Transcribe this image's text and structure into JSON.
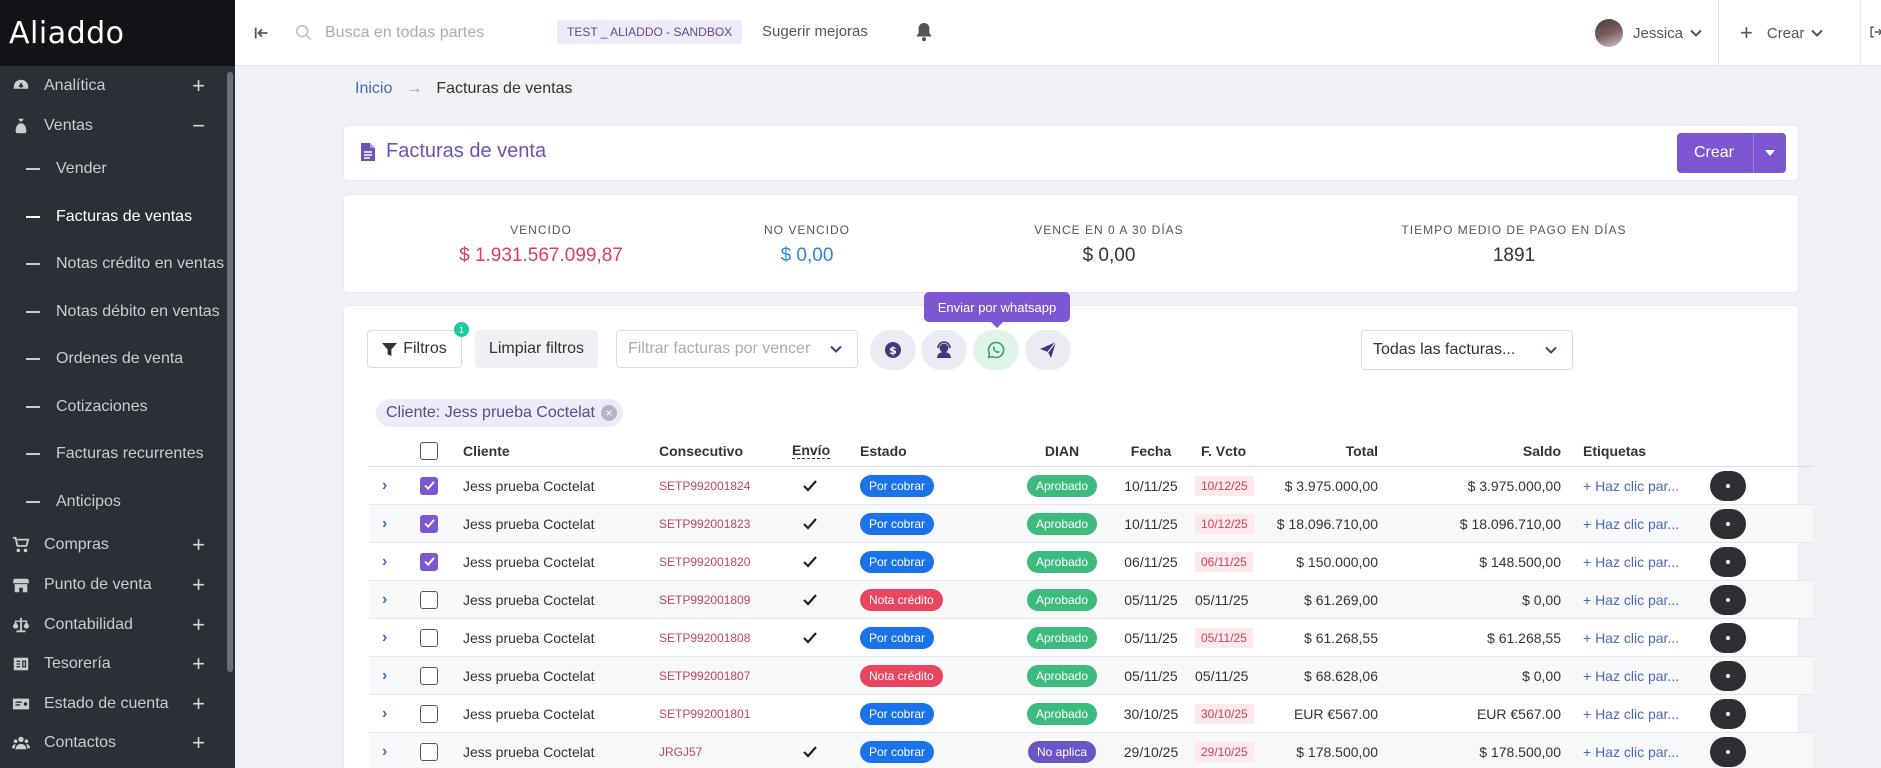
{
  "app": {
    "logo": "Aliaddo"
  },
  "sidebar": {
    "items": [
      {
        "label": "Analítica",
        "icon": "dashboard-icon",
        "toggle": "+"
      },
      {
        "label": "Ventas",
        "icon": "money-bag-icon",
        "toggle": "−"
      },
      {
        "label": "Compras",
        "icon": "cart-icon",
        "toggle": "+"
      },
      {
        "label": "Punto de venta",
        "icon": "store-icon",
        "toggle": "+"
      },
      {
        "label": "Contabilidad",
        "icon": "balance-scale-icon",
        "toggle": "+"
      },
      {
        "label": "Tesorería",
        "icon": "cash-register-icon",
        "toggle": "+"
      },
      {
        "label": "Estado de cuenta",
        "icon": "account-statement-icon",
        "toggle": "+"
      },
      {
        "label": "Contactos",
        "icon": "users-icon",
        "toggle": "+"
      }
    ],
    "sub_items": [
      {
        "label": "Vender"
      },
      {
        "label": "Facturas de ventas"
      },
      {
        "label": "Notas crédito en ventas"
      },
      {
        "label": "Notas débito en ventas"
      },
      {
        "label": "Ordenes de venta"
      },
      {
        "label": "Cotizaciones"
      },
      {
        "label": "Facturas recurrentes"
      },
      {
        "label": "Anticipos"
      }
    ],
    "active_sub_item": "Facturas de ventas"
  },
  "topbar": {
    "search_placeholder": "Busca en todas partes",
    "environment": "TEST _ ALIADDO - SANDBOX",
    "suggest": "Sugerir mejoras",
    "user_name": "Jessica",
    "create_label": "Crear"
  },
  "breadcrumb": {
    "home": "Inicio",
    "separator": "→",
    "current": "Facturas de ventas"
  },
  "page": {
    "title": "Facturas de venta",
    "create_button": "Crear"
  },
  "stats": [
    {
      "label": "VENCIDO",
      "value": "$ 1.931.567.099,87",
      "color": "#d9405e"
    },
    {
      "label": "NO VENCIDO",
      "value": "$ 0,00",
      "color": "#2f86d6"
    },
    {
      "label": "VENCE EN 0 A 30 DÍAS",
      "value": "$ 0,00",
      "color": "#333333"
    },
    {
      "label": "TIEMPO MEDIO DE PAGO EN DÍAS",
      "value": "1891",
      "color": "#333333"
    }
  ],
  "toolbar": {
    "filters_label": "Filtros",
    "filters_count": "1",
    "clear_filters": "Limpiar filtros",
    "due_placeholder": "Filtrar facturas por vencer",
    "whatsapp_tooltip": "Enviar por whatsapp",
    "all_invoices": "Todas las facturas..."
  },
  "active_filter": {
    "label": "Cliente: Jess prueba Coctelat"
  },
  "table": {
    "headers": {
      "cliente": "Cliente",
      "consecutivo": "Consecutivo",
      "envio": "Envío",
      "estado": "Estado",
      "dian": "DIAN",
      "fecha": "Fecha",
      "vcto": "F. Vcto",
      "total": "Total",
      "saldo": "Saldo",
      "etiquetas": "Etiquetas"
    },
    "rows": [
      {
        "cliente": "Jess prueba Coctelat",
        "consecutivo": "SETP992001824",
        "envio": true,
        "estado": "Por cobrar",
        "dian": "Aprobado",
        "fecha": "10/11/25",
        "vcto": "10/12/25",
        "vcto_overdue": true,
        "total": "$ 3.975.000,00",
        "saldo": "$ 3.975.000,00",
        "etiquetas": "+ Haz clic par...",
        "checked": true
      },
      {
        "cliente": "Jess prueba Coctelat",
        "consecutivo": "SETP992001823",
        "envio": true,
        "estado": "Por cobrar",
        "dian": "Aprobado",
        "fecha": "10/11/25",
        "vcto": "10/12/25",
        "vcto_overdue": true,
        "total": "$ 18.096.710,00",
        "saldo": "$ 18.096.710,00",
        "etiquetas": "+ Haz clic par...",
        "checked": true
      },
      {
        "cliente": "Jess prueba Coctelat",
        "consecutivo": "SETP992001820",
        "envio": true,
        "estado": "Por cobrar",
        "dian": "Aprobado",
        "fecha": "06/11/25",
        "vcto": "06/11/25",
        "vcto_overdue": true,
        "total": "$ 150.000,00",
        "saldo": "$ 148.500,00",
        "etiquetas": "+ Haz clic par...",
        "checked": true
      },
      {
        "cliente": "Jess prueba Coctelat",
        "consecutivo": "SETP992001809",
        "envio": true,
        "estado": "Nota crédito",
        "dian": "Aprobado",
        "fecha": "05/11/25",
        "vcto": "05/11/25",
        "vcto_overdue": false,
        "total": "$ 61.269,00",
        "saldo": "$ 0,00",
        "etiquetas": "+ Haz clic par...",
        "checked": false
      },
      {
        "cliente": "Jess prueba Coctelat",
        "consecutivo": "SETP992001808",
        "envio": true,
        "estado": "Por cobrar",
        "dian": "Aprobado",
        "fecha": "05/11/25",
        "vcto": "05/11/25",
        "vcto_overdue": true,
        "total": "$ 61.268,55",
        "saldo": "$ 61.268,55",
        "etiquetas": "+ Haz clic par...",
        "checked": false
      },
      {
        "cliente": "Jess prueba Coctelat",
        "consecutivo": "SETP992001807",
        "envio": false,
        "estado": "Nota crédito",
        "dian": "Aprobado",
        "fecha": "05/11/25",
        "vcto": "05/11/25",
        "vcto_overdue": false,
        "total": "$ 68.628,06",
        "saldo": "$ 0,00",
        "etiquetas": "+ Haz clic par...",
        "checked": false
      },
      {
        "cliente": "Jess prueba Coctelat",
        "consecutivo": "SETP992001801",
        "envio": false,
        "estado": "Por cobrar",
        "dian": "Aprobado",
        "fecha": "30/10/25",
        "vcto": "30/10/25",
        "vcto_overdue": true,
        "total": "EUR €567.00",
        "saldo": "EUR €567.00",
        "etiquetas": "+ Haz clic par...",
        "checked": false
      },
      {
        "cliente": "Jess prueba Coctelat",
        "consecutivo": "JRGJ57",
        "envio": true,
        "estado": "Por cobrar",
        "dian": "No aplica",
        "fecha": "29/10/25",
        "vcto": "29/10/25",
        "vcto_overdue": true,
        "total": "$ 178.500,00",
        "saldo": "$ 178.500,00",
        "etiquetas": "+ Haz clic par...",
        "checked": false
      }
    ]
  },
  "colors": {
    "accent": "#7c57d1",
    "por_cobrar": "#1a73e8",
    "nota_credito": "#e8455f",
    "aprobado": "#3dbb7e",
    "no_aplica": "#6a55c7"
  }
}
